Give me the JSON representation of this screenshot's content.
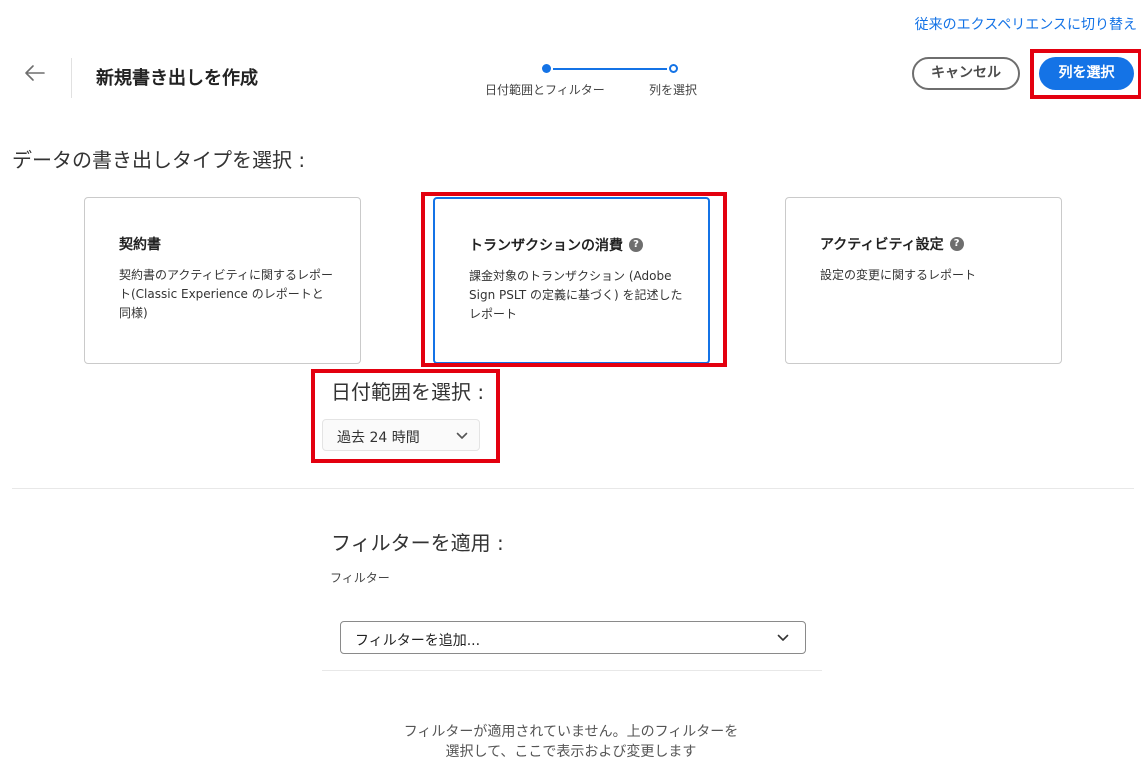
{
  "header": {
    "switch_link": "従来のエクスペリエンスに切り替え",
    "title": "新規書き出しを作成",
    "cancel_label": "キャンセル",
    "next_label": "列を選択"
  },
  "stepper": {
    "steps": [
      {
        "label": "日付範囲とフィルター",
        "state": "current"
      },
      {
        "label": "列を選択",
        "state": "upcoming"
      }
    ]
  },
  "export_type": {
    "heading": "データの書き出しタイプを選択 :",
    "cards": [
      {
        "title": "契約書",
        "description": "契約書のアクティビティに関するレポート(Classic Experience のレポートと同様)",
        "has_help": false,
        "selected": false
      },
      {
        "title": "トランザクションの消費",
        "description": "課金対象のトランザクション (Adobe Sign PSLT の定義に基づく) を記述したレポート",
        "has_help": true,
        "selected": true
      },
      {
        "title": "アクティビティ設定",
        "description": "設定の変更に関するレポート",
        "has_help": true,
        "selected": false
      }
    ]
  },
  "date_range": {
    "heading": "日付範囲を選択 :",
    "selected": "過去 24 時間"
  },
  "filters": {
    "heading": "フィルターを適用 :",
    "label": "フィルター",
    "placeholder": "フィルターを追加...",
    "empty_message": "フィルターが適用されていません。上のフィルターを選択して、ここで表示および変更します"
  },
  "icons": {
    "back": "arrow-left-icon",
    "help": "help-circle-icon",
    "chevron": "chevron-down-icon"
  },
  "colors": {
    "accent": "#1473e6",
    "highlight": "#e3000f"
  }
}
